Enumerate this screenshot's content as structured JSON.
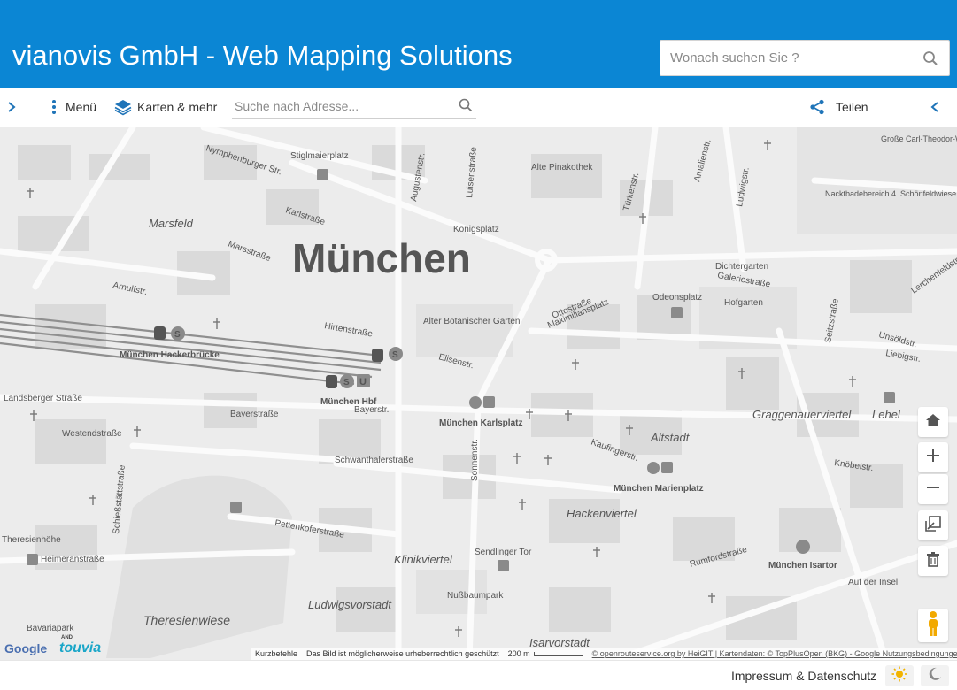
{
  "header": {
    "title": "vianovis GmbH - Web Mapping Solutions",
    "search_placeholder": "Wonach suchen Sie ?"
  },
  "toolbar": {
    "menu_label": "Menü",
    "maps_label": "Karten & mehr",
    "address_placeholder": "Suche nach Adresse...",
    "share_label": "Teilen"
  },
  "map": {
    "city_label": "München",
    "district_labels": [
      "Marsfeld",
      "Altstadt",
      "Hackenviertel",
      "Klinikviertel",
      "Ludwigsvorstadt",
      "Graggenauerviertel",
      "Lehel",
      "Isarvorstadt",
      "Theresienwiese"
    ],
    "street_labels": [
      "Nymphenburger Str.",
      "Stiglmaierplatz",
      "Karlstraße",
      "Marsstraße",
      "Arnulfstr.",
      "Hirtenstraße",
      "Elisenstr.",
      "Bayerstraße",
      "Landsberger Straße",
      "Westendstraße",
      "Schwanthalerstraße",
      "Pettenkoferstraße",
      "Heimeranstraße",
      "Sonnenstr.",
      "Sendlinger Tor",
      "Maximiliansplatz",
      "Ottostraße",
      "Galeriestraße",
      "Odeonsplatz",
      "Kaufingerstr.",
      "Rumfordstraße",
      "Knöbelstr.",
      "Königsplatz",
      "Alte Pinakothek",
      "Alter Botanischer Garten",
      "Hofgarten",
      "Dichtergarten",
      "Nußbaumpark",
      "Bavariapark",
      "Nacktbadebereich 4. Schönfeldwiese",
      "Große Carl-Theodor-Wiese",
      "Auf der Insel",
      "Seitzstraße",
      "Unsöldstr.",
      "Liebigstr.",
      "Lerchenfeldstr.",
      "Luisenstraße",
      "Augustenstr.",
      "Türkenstr.",
      "Amalienstr.",
      "Ludwigstr.",
      "Theresienhöhe",
      "Schießstättstraße",
      "Bayerstr."
    ],
    "station_labels": [
      "München Hackerbrücke",
      "München Hbf",
      "München Karlsplatz",
      "München Marienplatz",
      "München Isartor"
    ],
    "logos": {
      "google": "Google",
      "and": "AND",
      "touvia": "touvia"
    },
    "attribution": {
      "shortcuts": "Kurzbefehle",
      "copyright_note": "Das Bild ist möglicherweise urheberrechtlich geschützt",
      "scale": "200 m",
      "credits": "© openrouteservice.org by HeiGIT | Kartendaten: © TopPlusOpen (BKG) - Google Nutzungsbedingungen"
    },
    "controls": [
      "home-icon",
      "zoom-in-icon",
      "zoom-out-icon",
      "fullscreen-icon",
      "trash-icon",
      "street-view-icon"
    ]
  },
  "footer": {
    "imprint_label": "Impressum & Datenschutz",
    "light_mode_icon": "sun-icon",
    "dark_mode_icon": "moon-icon"
  },
  "colors": {
    "header_bg": "#0b86d4",
    "accent": "#1f74b8",
    "map_bg": "#ececec"
  }
}
